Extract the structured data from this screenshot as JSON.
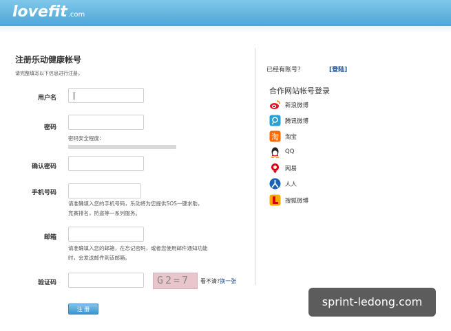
{
  "header": {
    "logo_text": "lovefit",
    "logo_suffix": ".com"
  },
  "form": {
    "title": "注册乐动健康帐号",
    "subtitle": "请完整填写以下信息进行注册。",
    "username_label": "用户名",
    "password_label": "密码",
    "password_strength_label": "密码安全程度：",
    "confirm_password_label": "确认密码",
    "phone_label": "手机号码",
    "phone_hint_line1": "请准确填入您的手机号码，乐动将为您提供SOS一键求助，",
    "phone_hint_line2": "竞赛排名，防盗等一系列服务。",
    "email_label": "邮箱",
    "email_hint_line1": "请准确填入您的邮箱，在忘记密码，或者您使用邮件通知功能",
    "email_hint_line2": "时，会发送邮件到该邮箱。",
    "captcha_label": "验证码",
    "captcha_text": "G2=7",
    "refresh_prefix": "看不清?",
    "refresh_link": "换一张",
    "submit_label": "注 册"
  },
  "sidebar": {
    "have_account": "已经有账号？",
    "login_link": "[登陆]",
    "partner_title": "合作网站帐号登录",
    "partners": [
      {
        "label": "新浪微博",
        "icon": "weibo-icon",
        "color": "#e6162d"
      },
      {
        "label": "腾讯微博",
        "icon": "tencent-weibo-icon",
        "color": "#2a9fd6"
      },
      {
        "label": "淘宝",
        "icon": "taobao-icon",
        "color": "#ff6a00"
      },
      {
        "label": "QQ",
        "icon": "qq-icon",
        "color": "#222222"
      },
      {
        "label": "网易",
        "icon": "netease-icon",
        "color": "#d7000f"
      },
      {
        "label": "人人",
        "icon": "renren-icon",
        "color": "#1a62b5"
      },
      {
        "label": "搜狐微博",
        "icon": "sohu-weibo-icon",
        "color": "#f5a800"
      }
    ]
  },
  "watermark": "sprint-ledong.com"
}
